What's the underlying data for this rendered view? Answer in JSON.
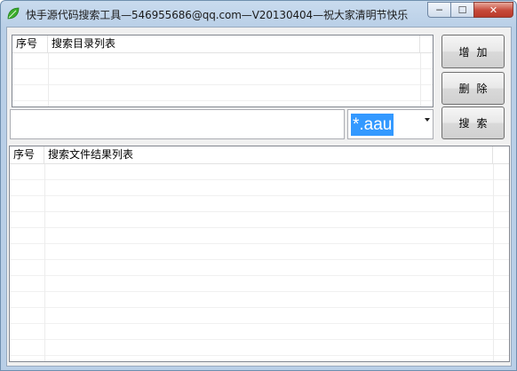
{
  "window": {
    "title": "快手源代码搜索工具—546955686@qq.com—V20130404—祝大家清明节快乐",
    "min_glyph": "─",
    "max_glyph": "☐",
    "close_glyph": "✕",
    "icon": "green-leaf-icon"
  },
  "dir_list": {
    "columns": [
      "序号",
      "搜索目录列表"
    ]
  },
  "buttons": {
    "add": "增加",
    "delete": "删除",
    "search": "搜索"
  },
  "path_input": {
    "value": ""
  },
  "filter": {
    "value": "*.aau"
  },
  "result_list": {
    "columns": [
      "序号",
      "搜索文件结果列表"
    ]
  }
}
